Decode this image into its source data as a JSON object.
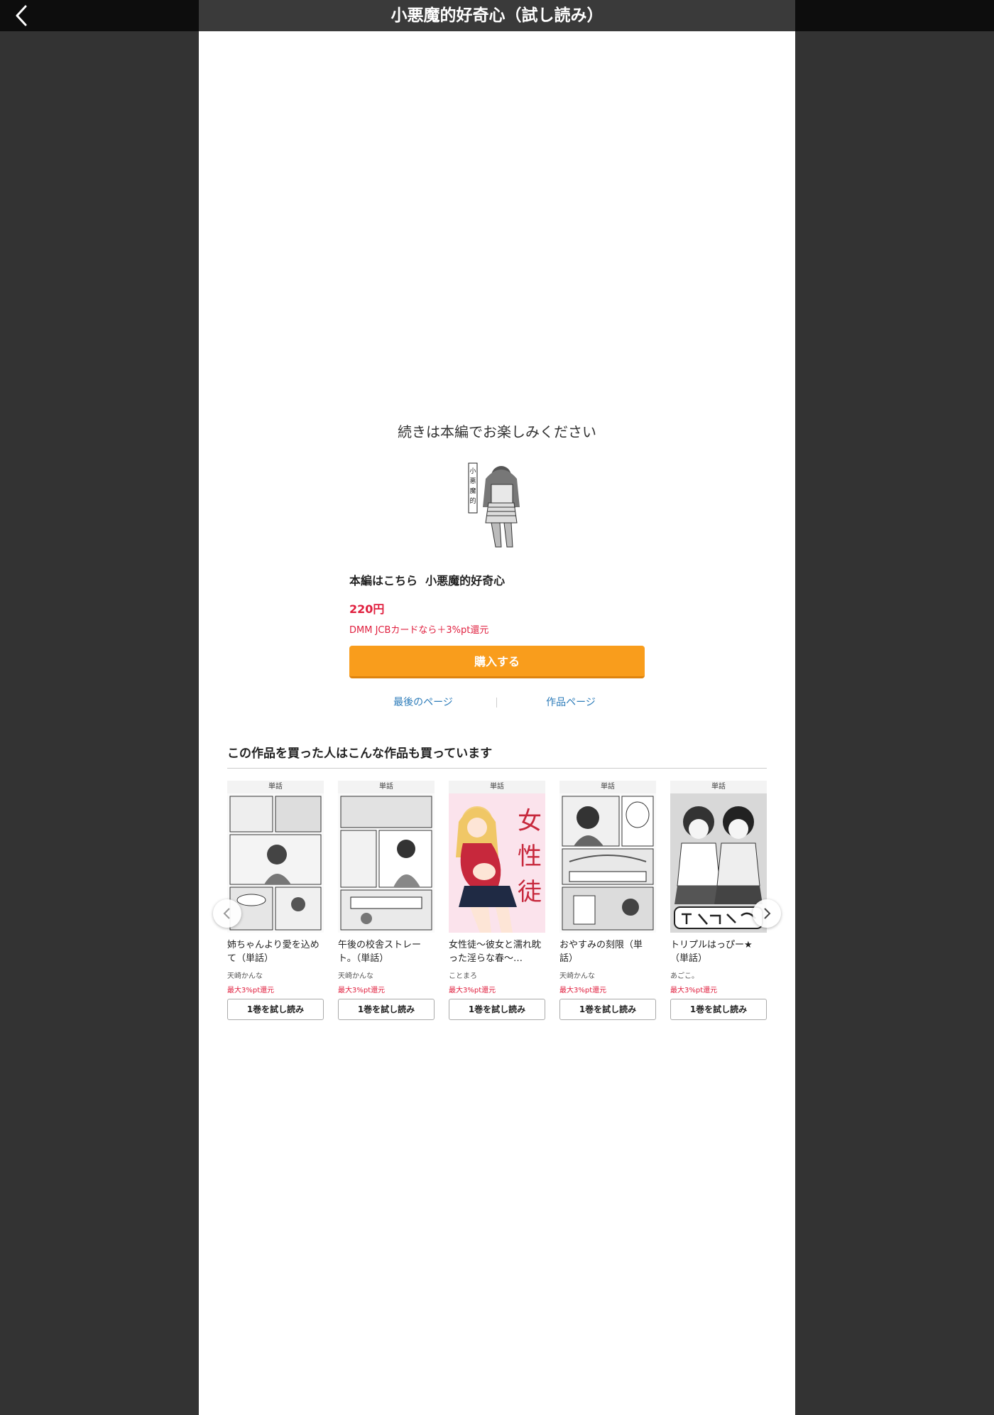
{
  "header": {
    "title": "小悪魔的好奇心（試し読み）",
    "back_icon": "chevron-left-icon"
  },
  "main": {
    "continue_text": "続きは本編でお楽しみください",
    "honpen_label": "本編はこちら",
    "book_title": "小悪魔的好奇心",
    "price": "220円",
    "card_note": "DMM JCBカードなら＋3%pt還元",
    "buy_label": "購入する",
    "last_page_link": "最後のページ",
    "work_page_link": "作品ページ"
  },
  "recommend": {
    "heading": "この作品を買った人はこんな作品も買っています",
    "items": [
      {
        "badge": "単話",
        "title": "姉ちゃんより愛を込めて（単話）",
        "author": "天崎かんな",
        "points": "最大3%pt還元",
        "trial": "1巻を試し読み"
      },
      {
        "badge": "単話",
        "title": "午後の校舎ストレート。（単話）",
        "author": "天崎かんな",
        "points": "最大3%pt還元",
        "trial": "1巻を試し読み"
      },
      {
        "badge": "単話",
        "title": "女性徒～彼女と濡れ眈った淫らな春～…",
        "author": "ことまろ",
        "points": "最大3%pt還元",
        "trial": "1巻を試し読み"
      },
      {
        "badge": "単話",
        "title": "おやすみの刻限（単話）",
        "author": "天崎かんな",
        "points": "最大3%pt還元",
        "trial": "1巻を試し読み"
      },
      {
        "badge": "単話",
        "title": "トリプルはっぴー★（単話）",
        "author": "あごこ。",
        "points": "最大3%pt還元",
        "trial": "1巻を試し読み"
      }
    ]
  },
  "colors": {
    "accent_orange": "#f99d1c",
    "price_red": "#e0203f",
    "link_blue": "#2b7bb9"
  }
}
